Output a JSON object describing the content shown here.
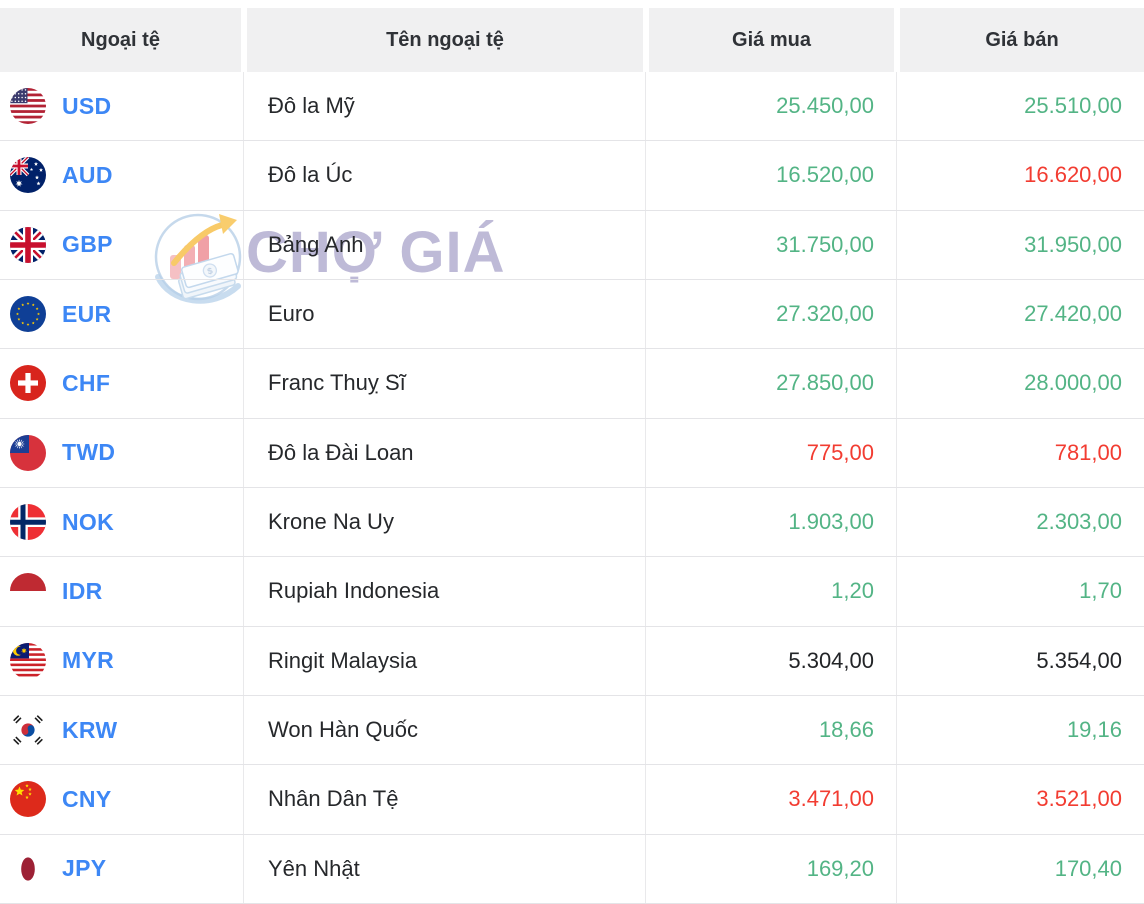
{
  "header": {
    "columns": [
      "Ngoại tệ",
      "Tên ngoại tệ",
      "Giá mua",
      "Giá bán"
    ]
  },
  "watermark": {
    "text": "CHỢ GIÁ",
    "icon": "cho-gia-logo-icon",
    "text_color": "#6a63a5"
  },
  "colors": {
    "up": "#53b485",
    "down": "#f23c31",
    "neutral": "#222427",
    "code_link": "#3d87f5",
    "header_bg": "#f0f0f1",
    "row_border": "#e4e4e7"
  },
  "table": {
    "rows": [
      {
        "code": "USD",
        "flag": "flag-usa",
        "name": "Đô la Mỹ",
        "buy": "25.450,00",
        "buy_trend": "up",
        "sell": "25.510,00",
        "sell_trend": "up"
      },
      {
        "code": "AUD",
        "flag": "flag-australia",
        "name": "Đô la Úc",
        "buy": "16.520,00",
        "buy_trend": "up",
        "sell": "16.620,00",
        "sell_trend": "down"
      },
      {
        "code": "GBP",
        "flag": "flag-uk",
        "name": "Bảng Anh",
        "buy": "31.750,00",
        "buy_trend": "up",
        "sell": "31.950,00",
        "sell_trend": "up"
      },
      {
        "code": "EUR",
        "flag": "flag-eu",
        "name": "Euro",
        "buy": "27.320,00",
        "buy_trend": "up",
        "sell": "27.420,00",
        "sell_trend": "up"
      },
      {
        "code": "CHF",
        "flag": "flag-switzerland",
        "name": "Franc Thuỵ Sĩ",
        "buy": "27.850,00",
        "buy_trend": "up",
        "sell": "28.000,00",
        "sell_trend": "up"
      },
      {
        "code": "TWD",
        "flag": "flag-taiwan",
        "name": "Đô la Đài Loan",
        "buy": "775,00",
        "buy_trend": "down",
        "sell": "781,00",
        "sell_trend": "down"
      },
      {
        "code": "NOK",
        "flag": "flag-norway",
        "name": "Krone Na Uy",
        "buy": "1.903,00",
        "buy_trend": "up",
        "sell": "2.303,00",
        "sell_trend": "up"
      },
      {
        "code": "IDR",
        "flag": "flag-indonesia",
        "name": "Rupiah Indonesia",
        "buy": "1,20",
        "buy_trend": "up",
        "sell": "1,70",
        "sell_trend": "up"
      },
      {
        "code": "MYR",
        "flag": "flag-malaysia",
        "name": "Ringit Malaysia",
        "buy": "5.304,00",
        "buy_trend": "neutral",
        "sell": "5.354,00",
        "sell_trend": "neutral"
      },
      {
        "code": "KRW",
        "flag": "flag-south-korea",
        "name": "Won Hàn Quốc",
        "buy": "18,66",
        "buy_trend": "up",
        "sell": "19,16",
        "sell_trend": "up"
      },
      {
        "code": "CNY",
        "flag": "flag-china",
        "name": "Nhân Dân Tệ",
        "buy": "3.471,00",
        "buy_trend": "down",
        "sell": "3.521,00",
        "sell_trend": "down"
      },
      {
        "code": "JPY",
        "flag": "flag-japan",
        "name": "Yên Nhật",
        "buy": "169,20",
        "buy_trend": "up",
        "sell": "170,40",
        "sell_trend": "up"
      }
    ]
  }
}
